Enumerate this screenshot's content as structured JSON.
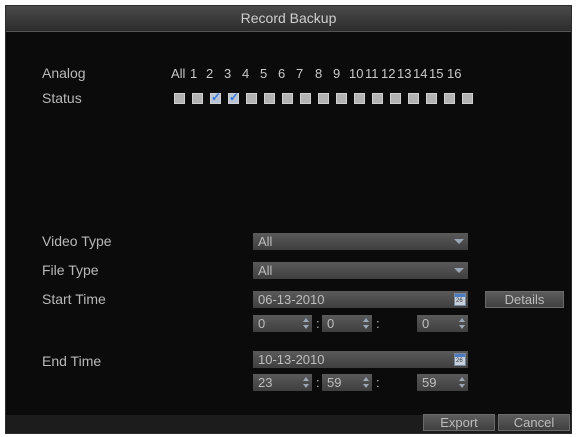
{
  "window": {
    "title": "Record Backup"
  },
  "camera": {
    "row_label": "Analog",
    "status_label": "Status",
    "all_label": "All",
    "channels": [
      "1",
      "2",
      "3",
      "4",
      "5",
      "6",
      "7",
      "8",
      "9",
      "10",
      "11",
      "12",
      "13",
      "14",
      "15",
      "16"
    ],
    "checked": [
      false,
      true,
      true,
      false,
      false,
      false,
      false,
      false,
      false,
      false,
      false,
      false,
      false,
      false,
      false,
      false
    ]
  },
  "form": {
    "video_type_label": "Video Type",
    "video_type_value": "All",
    "file_type_label": "File Type",
    "file_type_value": "All",
    "start_time_label": "Start Time",
    "start_date": "06-13-2010",
    "start_hour": "0",
    "start_min": "0",
    "start_sec": "0",
    "end_time_label": "End Time",
    "end_date": "10-13-2010",
    "end_hour": "23",
    "end_min": "59",
    "end_sec": "59",
    "time_sep": ":"
  },
  "buttons": {
    "details": "Details",
    "export": "Export",
    "cancel": "Cancel"
  },
  "colors": {
    "background": "#0b0b0b",
    "field": "#4b4b4b",
    "checkbox_tick": "#3b7bd4"
  },
  "icons": {
    "calendar": "calendar-icon",
    "dropdown": "chevron-down-icon",
    "spinner": "spinner-icon"
  }
}
